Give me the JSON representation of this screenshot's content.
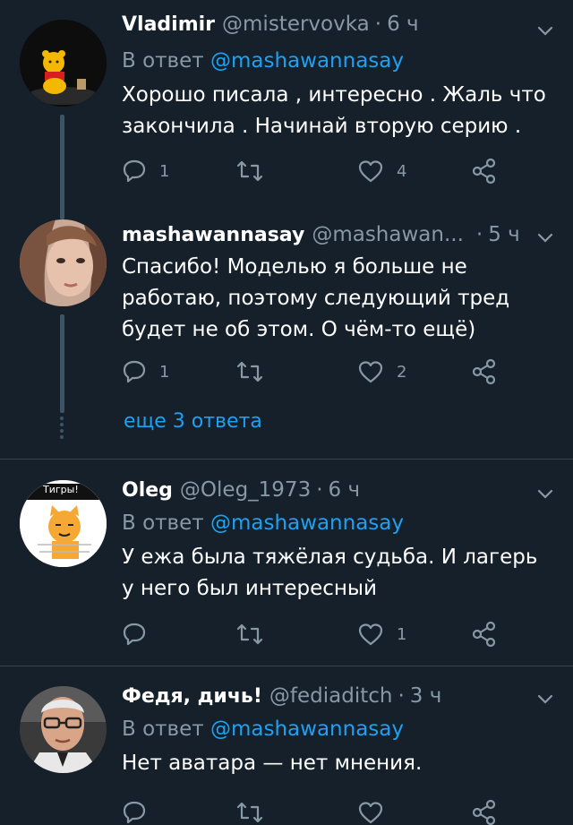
{
  "colors": {
    "background": "#15202b",
    "accent": "#1da1f2",
    "muted": "#8899a6",
    "divider": "#38444d"
  },
  "tweets": [
    {
      "name": "Vladimir",
      "handle": "@mistervovka",
      "separator": "·",
      "time": "6 ч",
      "reply_prefix": "В ответ",
      "reply_mention": "@mashawannasay",
      "text_lines": [
        "Хорошо писала , интересно . Жаль что",
        "закончила . Начинай вторую серию ."
      ],
      "replies": "1",
      "retweets": "",
      "likes": "4",
      "avatar_icon": "winnie-the-pooh-avatar"
    },
    {
      "name": "mashawannasay",
      "handle": "@mashawan...",
      "separator": "·",
      "time": "5 ч",
      "text_lines": [
        "Спасибо! Моделью я больше не",
        "работаю, поэтому следующий тред",
        "будет не об этом. О чём-то ещё)"
      ],
      "replies": "1",
      "retweets": "",
      "likes": "2",
      "avatar_icon": "woman-photo-avatar"
    },
    {
      "name": "Oleg",
      "handle": "@Oleg_1973",
      "separator": "·",
      "time": "6 ч",
      "reply_prefix": "В ответ",
      "reply_mention": "@mashawannasay",
      "text_lines": [
        "У ежа была тяжёлая судьба. И лагерь",
        "у него был интересный"
      ],
      "replies": "",
      "retweets": "",
      "likes": "1",
      "avatar_icon": "tiger-cat-avatar",
      "avatar_caption": "Тигры!"
    },
    {
      "name": "Федя, дичь!",
      "handle": "@fediaditch",
      "separator": "·",
      "time": "3 ч",
      "reply_prefix": "В ответ",
      "reply_mention": "@mashawannasay",
      "text_lines": [
        "Нет аватара — нет мнения."
      ],
      "replies": "",
      "retweets": "",
      "likes": "",
      "avatar_icon": "man-with-glasses-avatar"
    }
  ],
  "more_replies_label": "еще 3 ответа",
  "icons": {
    "reply": "reply-icon",
    "retweet": "retweet-icon",
    "like": "heart-icon",
    "share": "share-icon",
    "menu": "chevron-down-icon"
  }
}
